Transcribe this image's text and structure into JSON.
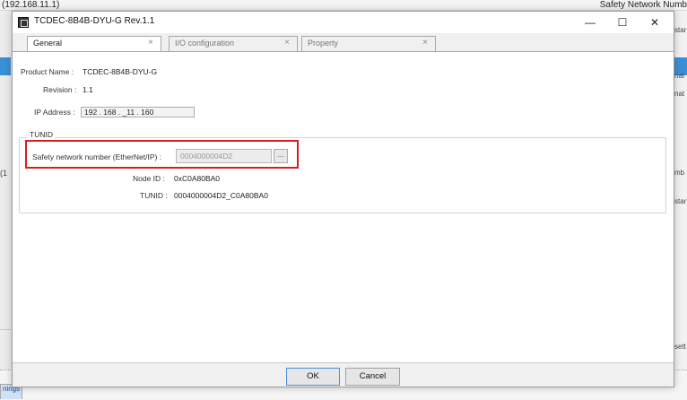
{
  "background": {
    "top_left_text": "(192.168.11.1)",
    "top_right_text": "Safety Network Numb",
    "left_fragment": "(1",
    "right_fragments": [
      "star",
      "nat",
      "nat",
      "mb",
      "star",
      "sett"
    ],
    "bottom_tab": "nings"
  },
  "dialog": {
    "title": "TCDEC-8B4B-DYU-G Rev.1.1",
    "minimize_glyph": "—",
    "maximize_glyph": "☐",
    "close_glyph": "✕",
    "tabs": [
      {
        "label": "General",
        "close": "×"
      },
      {
        "label": "I/O configuration",
        "close": "×"
      },
      {
        "label": "Property",
        "close": "×"
      }
    ],
    "product_name_label": "Product Name :",
    "product_name_value": "TCDEC-8B4B-DYU-G",
    "revision_label": "Revision :",
    "revision_value": "1.1",
    "ip_label": "IP Address :",
    "ip_value": "192 . 168 . _11 . 160",
    "tunid_group_label": "TUNID",
    "snn_label": "Safety network number (EtherNet/IP) :",
    "snn_value": "0004000004D2",
    "snn_button": "...",
    "node_id_label": "Node ID :",
    "node_id_value": "0xC0A80BA0",
    "tunid_label": "TUNID :",
    "tunid_value": "0004000004D2_C0A80BA0",
    "ok_label": "OK",
    "cancel_label": "Cancel"
  },
  "colors": {
    "highlight": "#d41f1f",
    "selection_blue": "#3c8fd6"
  }
}
